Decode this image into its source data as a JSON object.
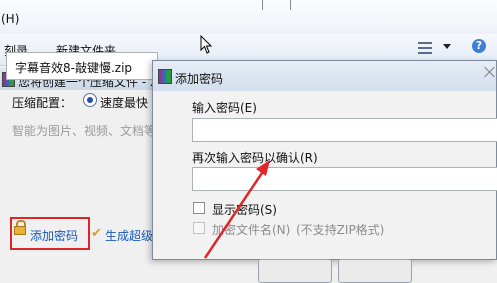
{
  "menubar": {
    "letter": "(H)"
  },
  "toolbar": {
    "burn_label": "刻录",
    "new_folder_label": "新建文件夹"
  },
  "background_dialog": {
    "title": "您将创建一个压缩文件 - 2",
    "filename": "字幕音效8-敲键慢.zip",
    "compression_label": "压缩配置：",
    "compression_option": "速度最快",
    "hint": "智能为图片、视频、文档等",
    "add_password": "添加密码",
    "generate_label": "生成超级"
  },
  "password_dialog": {
    "title": "添加密码",
    "password_label": "输入密码(E)",
    "confirm_label": "再次输入密码以确认(R)",
    "show_password_label": "显示密码(S)",
    "encrypt_filenames_label": "加密文件名(N)",
    "encrypt_note": "(不支持ZIP格式)",
    "password_value": "",
    "confirm_value": ""
  },
  "colors": {
    "highlight": "#d9262a",
    "link": "#1a59b8",
    "arrow": "#e0262b"
  }
}
